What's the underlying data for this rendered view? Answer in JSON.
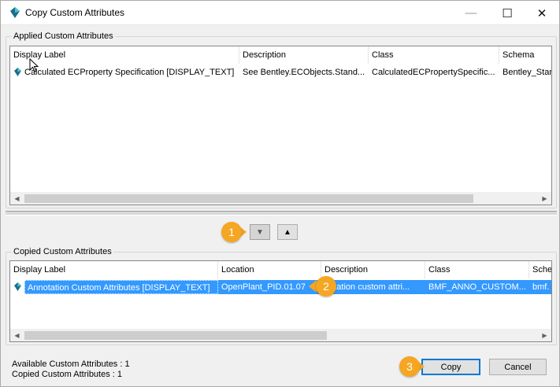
{
  "window": {
    "title": "Copy Custom Attributes",
    "controls": {
      "minimize": "—",
      "maximize": "☐",
      "close": "✕"
    }
  },
  "applied": {
    "group_label": "Applied Custom Attributes",
    "columns": [
      "Display Label",
      "Description",
      "Class",
      "Schema"
    ],
    "rows": [
      {
        "display_label": "Calculated ECProperty Specification [DISPLAY_TEXT]",
        "description": "See Bentley.ECObjects.Stand...",
        "class": "CalculatedECPropertySpecific...",
        "schema": "Bentley_Stan"
      }
    ]
  },
  "move_buttons": {
    "down": "▼",
    "up": "▲"
  },
  "copied": {
    "group_label": "Copied Custom Attributes",
    "columns": [
      "Display Label",
      "Location",
      "Description",
      "Class",
      "Sche"
    ],
    "rows": [
      {
        "display_label": "Annotation Custom Attributes [DISPLAY_TEXT]",
        "location": "OpenPlant_PID.01.07",
        "description": "notation custom attri...",
        "class": "BMF_ANNO_CUSTOM...",
        "schema": "bmf."
      }
    ]
  },
  "status": {
    "available": "Available Custom Attributes : 1",
    "copied": "Copied Custom Attributes : 1"
  },
  "buttons": {
    "copy": "Copy",
    "cancel": "Cancel"
  },
  "callouts": [
    "1",
    "2",
    "3"
  ],
  "colors": {
    "selection": "#3399ff",
    "callout": "#f5a623",
    "default_button_border": "#0078d7"
  }
}
